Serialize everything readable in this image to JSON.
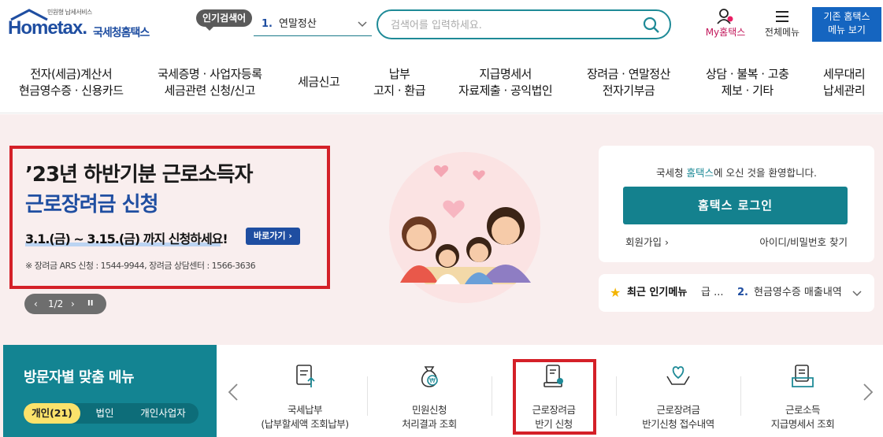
{
  "header": {
    "logo_tagline": "민원형 납세서비스",
    "logo_text": "Hometax.",
    "logo_korean": "국세청홈택스",
    "popular_badge": "인기검색어",
    "popular_num": "1.",
    "popular_term": "연말정산",
    "search_placeholder": "검색어를 입력하세요.",
    "my_hometax": "My홈택스",
    "all_menu": "전체메뉴",
    "old_btn_line1": "기존 홈택스",
    "old_btn_line2": "메뉴 보기"
  },
  "gnb": [
    {
      "l1": "전자(세금)계산서",
      "l2": "현금영수증 · 신용카드"
    },
    {
      "l1": "국세증명 · 사업자등록",
      "l2": "세금관련 신청/신고"
    },
    {
      "l1": "세금신고",
      "l2": ""
    },
    {
      "l1": "납부",
      "l2": "고지 · 환급"
    },
    {
      "l1": "지급명세서",
      "l2": "자료제출 · 공익법인"
    },
    {
      "l1": "장려금 · 연말정산",
      "l2": "전자기부금"
    },
    {
      "l1": "상담 · 불복 · 고충",
      "l2": "제보 · 기타"
    },
    {
      "l1": "세무대리",
      "l2": "납세관리"
    }
  ],
  "promo": {
    "line1": "’23년 하반기분 근로소득자",
    "line2": "근로장려금 신청",
    "period": "3.1.(금) ~ 3.15.(금) 까지 신청하세요!",
    "go_button": "바로가기",
    "contact": "※ 장려금 ARS 신청 : 1544-9944, 장려금 상담센터 : 1566-3636"
  },
  "pager": {
    "prev": "‹",
    "text": "1/2",
    "next": "›",
    "pause": "II"
  },
  "login": {
    "welcome_pre": "국세청 ",
    "welcome_hl": "홈택스",
    "welcome_post": "에 오신 것을 환영합니다.",
    "login_button": "홈택스 로그인",
    "join": "회원가입",
    "find": "아이디/비밀번호 찾기"
  },
  "recent": {
    "label": "최근 인기메뉴",
    "first": "급 ...",
    "num": "2.",
    "second": "현금영수증 매출내역"
  },
  "visitor": {
    "title": "방문자별 맞춤 메뉴",
    "tabs": [
      "개인(21)",
      "법인",
      "개인사업자"
    ]
  },
  "menus": [
    {
      "l1": "국세납부",
      "l2": "(납부할세액 조회납부)",
      "icon": "tax-payment-icon"
    },
    {
      "l1": "민원신청",
      "l2": "처리결과 조회",
      "icon": "money-bag-icon"
    },
    {
      "l1": "근로장려금",
      "l2": "반기 신청",
      "icon": "document-stamp-icon"
    },
    {
      "l1": "근로장려금",
      "l2": "반기신청 접수내역",
      "icon": "heart-hands-icon"
    },
    {
      "l1": "근로소득",
      "l2": "지급명세서 조회",
      "icon": "document-folder-icon"
    }
  ],
  "colors": {
    "primary": "#14818e",
    "brand_blue": "#1f4ea1",
    "highlight_red": "#d42028",
    "hero_bg": "#f9eeee"
  }
}
